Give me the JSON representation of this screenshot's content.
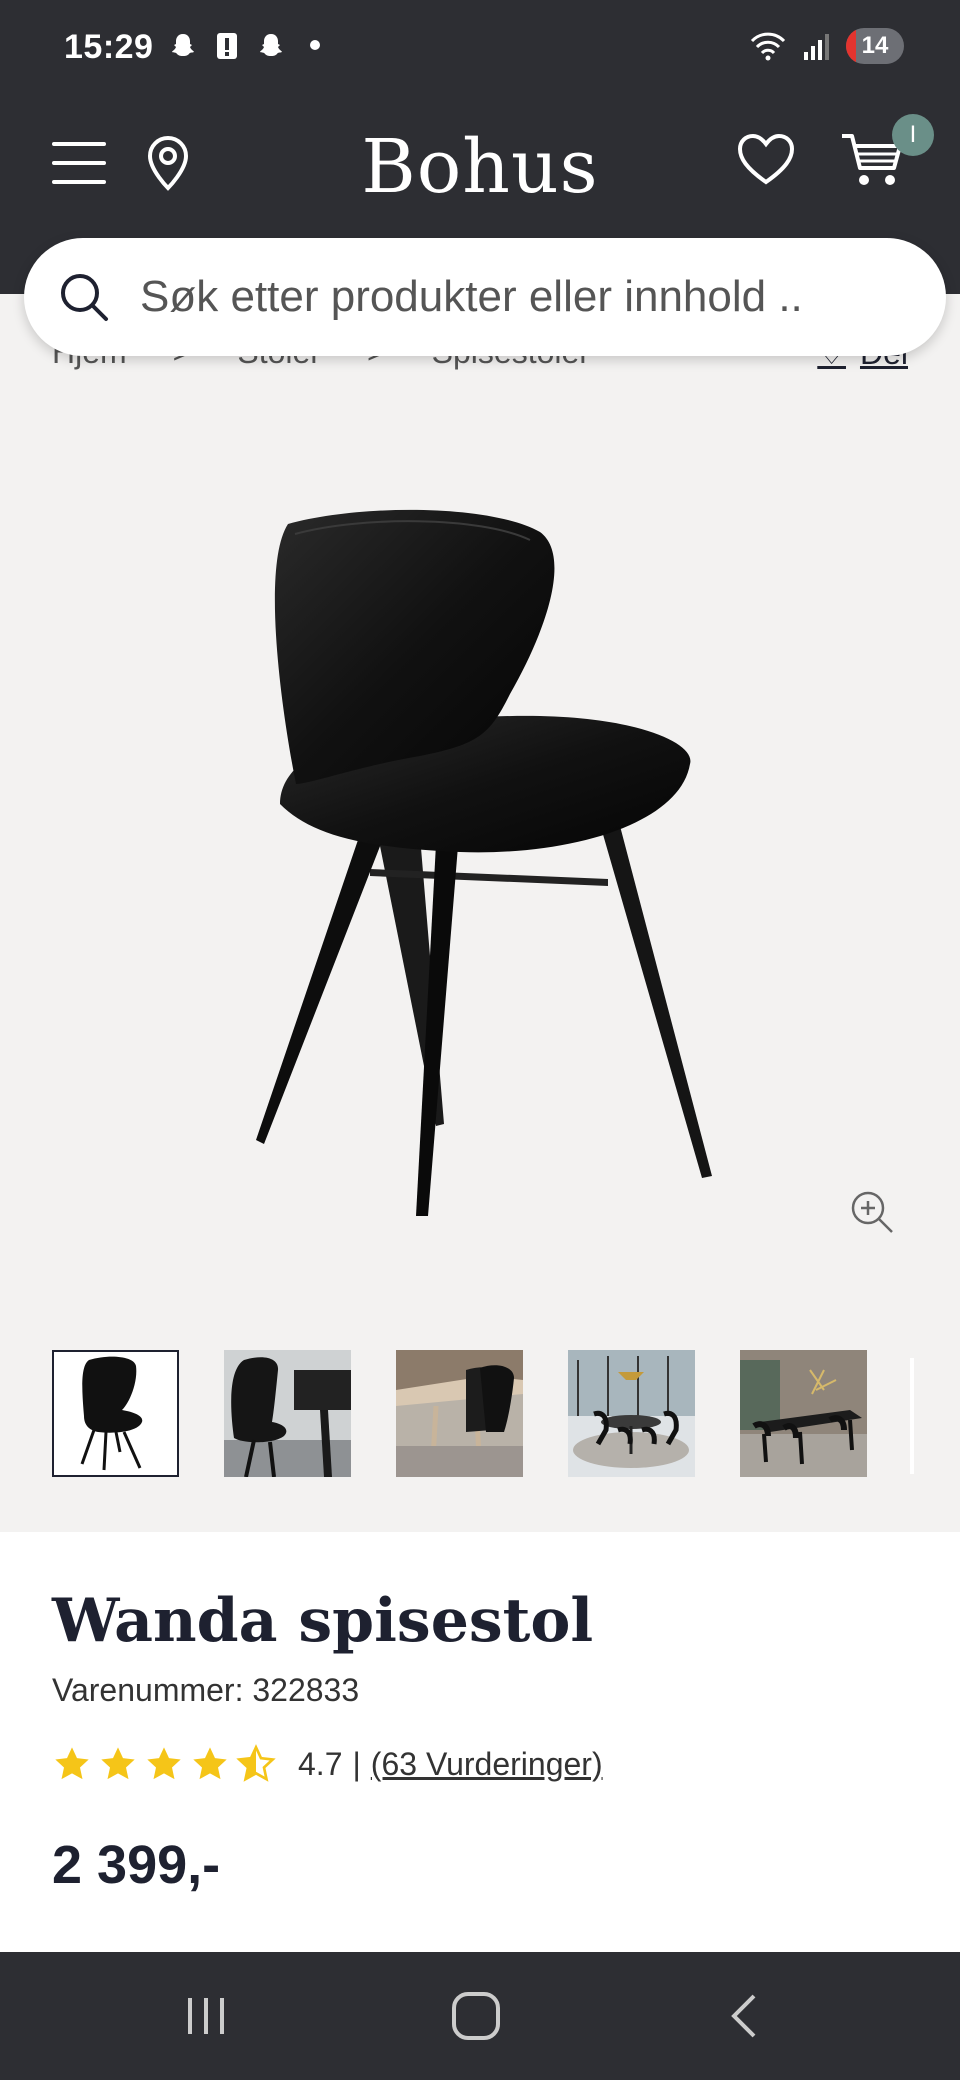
{
  "status": {
    "time": "15:29",
    "battery": "14"
  },
  "header": {
    "logo": "Bohus",
    "cart_count": "I"
  },
  "search": {
    "placeholder": "Søk etter produkter eller innhold .."
  },
  "breadcrumb": {
    "items": [
      "Hjem",
      "Stoler",
      "Spisestoler"
    ],
    "share_label": "Del"
  },
  "product": {
    "title": "Wanda spisestol",
    "sku": "Varenummer: 322833",
    "rating_value": "4.7",
    "rating_separator": "|",
    "rating_count": "(63 Vurderinger)",
    "rating_stars": 4.5,
    "price": "2 399,-"
  },
  "colors": {
    "header": "#2d2e33",
    "star": "#f5c518",
    "badge": "#6a8f88",
    "gallery_bg": "#f3f2f1"
  },
  "icons": [
    "menu-icon",
    "location-pin-icon",
    "heart-icon",
    "cart-icon",
    "search-icon",
    "zoom-in-icon",
    "recents-icon",
    "home-icon",
    "back-icon"
  ]
}
